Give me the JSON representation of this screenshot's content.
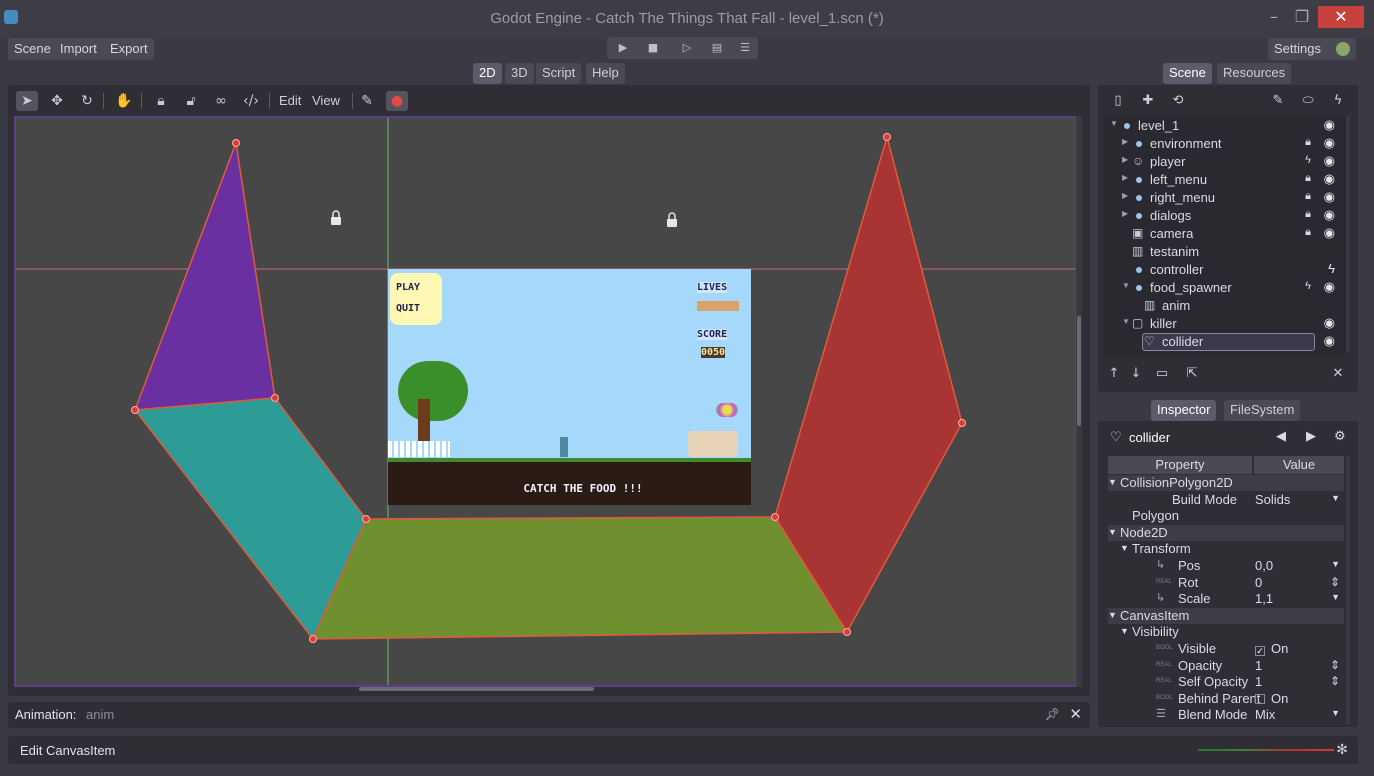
{
  "window": {
    "title": "Godot Engine - Catch The Things That Fall - level_1.scn (*)"
  },
  "menu": {
    "scene": "Scene",
    "import": "Import",
    "export": "Export",
    "settings": "Settings"
  },
  "main_tabs": [
    {
      "label": "2D",
      "active": true
    },
    {
      "label": "3D",
      "active": false
    },
    {
      "label": "Script",
      "active": false
    },
    {
      "label": "Help",
      "active": false
    }
  ],
  "toolbar2d": {
    "edit": "Edit",
    "view": "View"
  },
  "game": {
    "play": "PLAY",
    "quit": "QUIT",
    "lives": "LIVES",
    "score": "SCORE",
    "score_value": "0050",
    "caption": "CATCH THE FOOD !!!"
  },
  "animation": {
    "label": "Animation:",
    "value": "anim"
  },
  "status": {
    "label": "Edit CanvasItem"
  },
  "scene_dock": {
    "tabs": [
      {
        "label": "Scene",
        "active": true
      },
      {
        "label": "Resources",
        "active": false
      }
    ],
    "tree": [
      {
        "name": "level_1",
        "depth": 0,
        "icon": "node-dot",
        "arrow": "down",
        "r1": "",
        "r2": "eye"
      },
      {
        "name": "environment",
        "depth": 1,
        "icon": "node-dot",
        "arrow": "right",
        "r1": "lock",
        "r2": "eye"
      },
      {
        "name": "player",
        "depth": 1,
        "icon": "player-icon",
        "arrow": "right",
        "r1": "script",
        "r2": "eye"
      },
      {
        "name": "left_menu",
        "depth": 1,
        "icon": "node-dot",
        "arrow": "right",
        "r1": "lock",
        "r2": "eye"
      },
      {
        "name": "right_menu",
        "depth": 1,
        "icon": "node-dot",
        "arrow": "right",
        "r1": "lock",
        "r2": "eye"
      },
      {
        "name": "dialogs",
        "depth": 1,
        "icon": "node-dot",
        "arrow": "right",
        "r1": "lock",
        "r2": "eye"
      },
      {
        "name": "camera",
        "depth": 1,
        "icon": "camera-icon",
        "arrow": "",
        "r1": "lock",
        "r2": "eye"
      },
      {
        "name": "testanim",
        "depth": 1,
        "icon": "animation-icon",
        "arrow": "",
        "r1": "",
        "r2": ""
      },
      {
        "name": "controller",
        "depth": 1,
        "icon": "node-dot",
        "arrow": "",
        "r1": "",
        "r2": "script"
      },
      {
        "name": "food_spawner",
        "depth": 1,
        "icon": "node-dot",
        "arrow": "down",
        "r1": "script",
        "r2": "eye"
      },
      {
        "name": "anim",
        "depth": 2,
        "icon": "animation-icon",
        "arrow": "",
        "r1": "",
        "r2": ""
      },
      {
        "name": "killer",
        "depth": 1,
        "icon": "area-icon",
        "arrow": "down",
        "r1": "",
        "r2": "eye"
      },
      {
        "name": "collider",
        "depth": 2,
        "icon": "collision-polygon-icon",
        "arrow": "",
        "r1": "",
        "r2": "eye",
        "selected": true
      }
    ]
  },
  "inspector": {
    "tabs": [
      {
        "label": "Inspector",
        "active": true
      },
      {
        "label": "FileSystem",
        "active": false
      }
    ],
    "node_name": "collider",
    "columns": {
      "property": "Property",
      "value": "Value"
    },
    "rows": [
      {
        "type": "section",
        "label": "CollisionPolygon2D",
        "indent": 0
      },
      {
        "type": "prop",
        "label": "Build Mode",
        "value": "Solids",
        "indent": 2,
        "tag": "",
        "control": "dropdown"
      },
      {
        "type": "prop",
        "label": "Polygon",
        "value": "",
        "indent": 1,
        "tag": "",
        "control": ""
      },
      {
        "type": "section",
        "label": "Node2D",
        "indent": 0
      },
      {
        "type": "subsection",
        "label": "Transform",
        "indent": 1
      },
      {
        "type": "prop",
        "label": "Pos",
        "value": "0,0",
        "indent": 2,
        "tag": "vec",
        "control": "dropdown"
      },
      {
        "type": "prop",
        "label": "Rot",
        "value": "0",
        "indent": 2,
        "tag": "REAL",
        "control": "spin"
      },
      {
        "type": "prop",
        "label": "Scale",
        "value": "1,1",
        "indent": 2,
        "tag": "vec",
        "control": "dropdown"
      },
      {
        "type": "section",
        "label": "CanvasItem",
        "indent": 0
      },
      {
        "type": "subsection",
        "label": "Visibility",
        "indent": 1
      },
      {
        "type": "prop",
        "label": "Visible",
        "value": "On",
        "indent": 2,
        "tag": "BOOL",
        "control": "check-on"
      },
      {
        "type": "prop",
        "label": "Opacity",
        "value": "1",
        "indent": 2,
        "tag": "REAL",
        "control": "spin"
      },
      {
        "type": "prop",
        "label": "Self Opacity",
        "value": "1",
        "indent": 2,
        "tag": "REAL",
        "control": "spin"
      },
      {
        "type": "prop",
        "label": "Behind Parent",
        "value": "On",
        "indent": 2,
        "tag": "BOOL",
        "control": "check-off"
      },
      {
        "type": "prop",
        "label": "Blend Mode",
        "value": "Mix",
        "indent": 2,
        "tag": "list",
        "control": "dropdown"
      }
    ]
  },
  "colors": {
    "accent": "#5d5b6a",
    "polygon_purple": "#6a2fa0",
    "polygon_teal": "#2d9b96",
    "polygon_olive": "#6f902e",
    "polygon_red": "#a83434",
    "outline": "#e05a3c",
    "sky": "#a6d8fb"
  }
}
